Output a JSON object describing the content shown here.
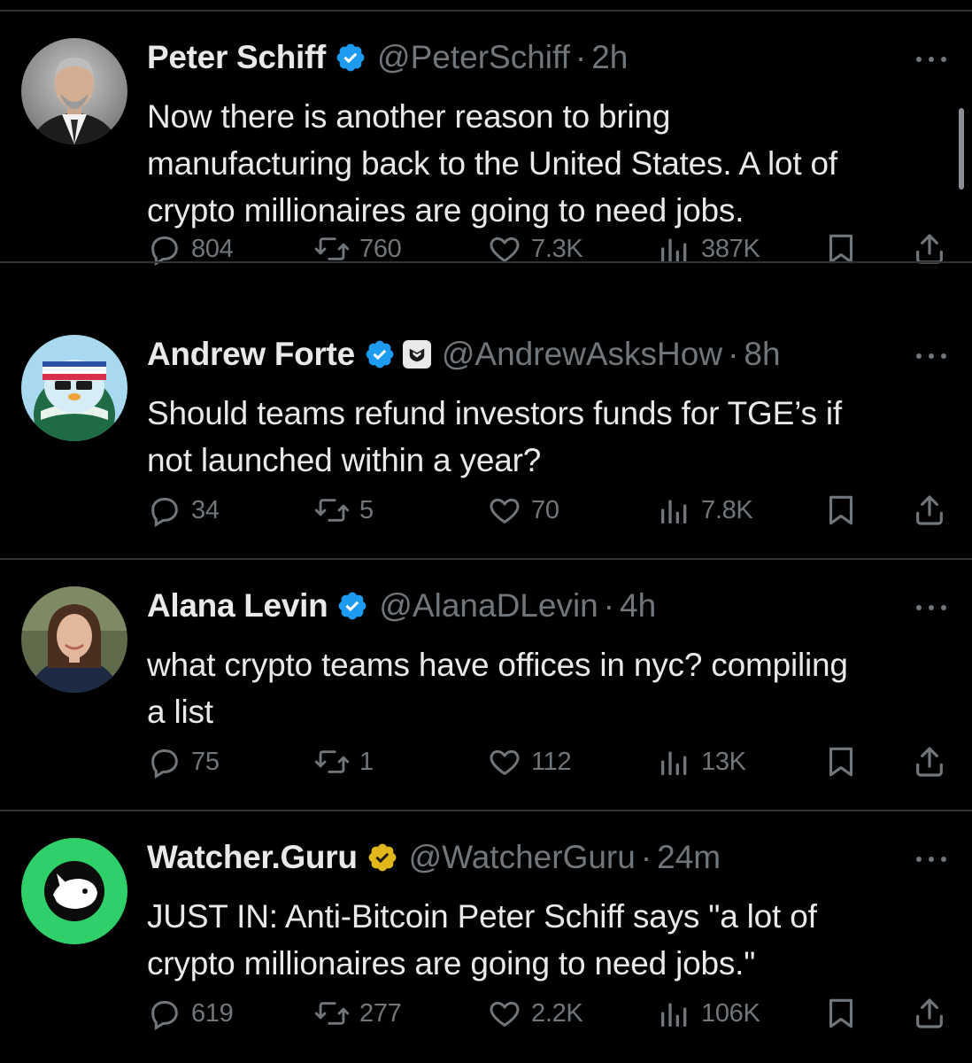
{
  "colors": {
    "background": "#000000",
    "text_primary": "#e7e9ea",
    "text_secondary": "#71767b",
    "verified_blue": "#1d9bf0",
    "verified_gold": "#e2b719",
    "divider": "#2f3336"
  },
  "tweets": [
    {
      "name": "Peter Schiff",
      "verified": "blue",
      "handle": "@PeterSchiff",
      "dot": "·",
      "time": "2h",
      "avatar_icon": "peter-schiff-avatar",
      "text_lines": [
        "Now there is another reason to bring",
        "manufacturing back to the United States. A lot of",
        "crypto millionaires are going to need jobs."
      ],
      "stats": {
        "replies": "804",
        "reposts": "760",
        "likes": "7.3K",
        "views": "387K"
      }
    },
    {
      "name": "Andrew Forte",
      "verified": "blue",
      "affiliate_badge": "shield-affiliate-icon",
      "handle": "@AndrewAsksHow",
      "dot": "·",
      "time": "8h",
      "avatar_icon": "penguin-avatar",
      "text_lines": [
        "Should teams refund investors funds for TGE’s if",
        "not launched within a year?"
      ],
      "stats": {
        "replies": "34",
        "reposts": "5",
        "likes": "70",
        "views": "7.8K"
      }
    },
    {
      "name": "Alana Levin",
      "verified": "blue",
      "handle": "@AlanaDLevin",
      "dot": "·",
      "time": "4h",
      "avatar_icon": "alana-levin-avatar",
      "text_lines": [
        "what crypto teams have offices in nyc? compiling",
        "a list"
      ],
      "stats": {
        "replies": "75",
        "reposts": "1",
        "likes": "112",
        "views": "13K"
      }
    },
    {
      "name": "Watcher.Guru",
      "verified": "gold",
      "handle": "@WatcherGuru",
      "dot": "·",
      "time": "24m",
      "avatar_icon": "whale-logo-avatar",
      "text_lines": [
        "JUST IN: Anti-Bitcoin Peter Schiff says \"a lot of",
        "crypto millionaires are going to need jobs.\""
      ],
      "stats": {
        "replies": "619",
        "reposts": "277",
        "likes": "2.2K",
        "views": "106K"
      }
    }
  ]
}
